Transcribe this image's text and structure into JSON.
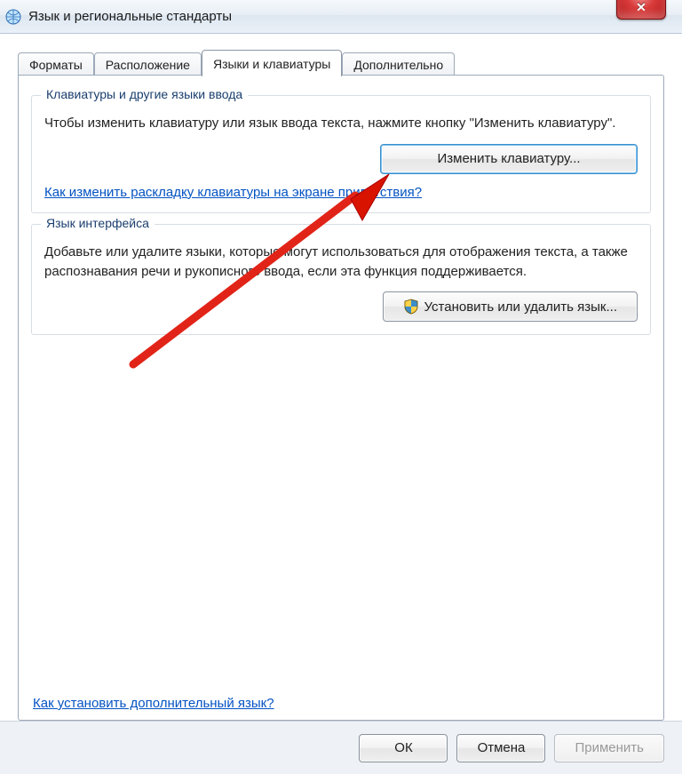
{
  "window": {
    "title": "Язык и региональные стандарты"
  },
  "tabs": {
    "formats": "Форматы",
    "location": "Расположение",
    "keyboards": "Языки и клавиатуры",
    "advanced": "Дополнительно"
  },
  "group1": {
    "legend": "Клавиатуры и другие языки ввода",
    "text": "Чтобы изменить клавиатуру или язык ввода текста, нажмите кнопку \"Изменить клавиатуру\".",
    "button": "Изменить клавиатуру...",
    "link": "Как изменить раскладку клавиатуры на экране приветствия?"
  },
  "group2": {
    "legend": "Язык интерфейса",
    "text": "Добавьте или удалите языки, которые могут использоваться для отображения текста, а также распознавания речи и рукописного ввода, если эта функция поддерживается.",
    "button": "Установить или удалить язык..."
  },
  "bottom_link": "Как установить дополнительный язык?",
  "footer": {
    "ok": "ОК",
    "cancel": "Отмена",
    "apply": "Применить"
  }
}
